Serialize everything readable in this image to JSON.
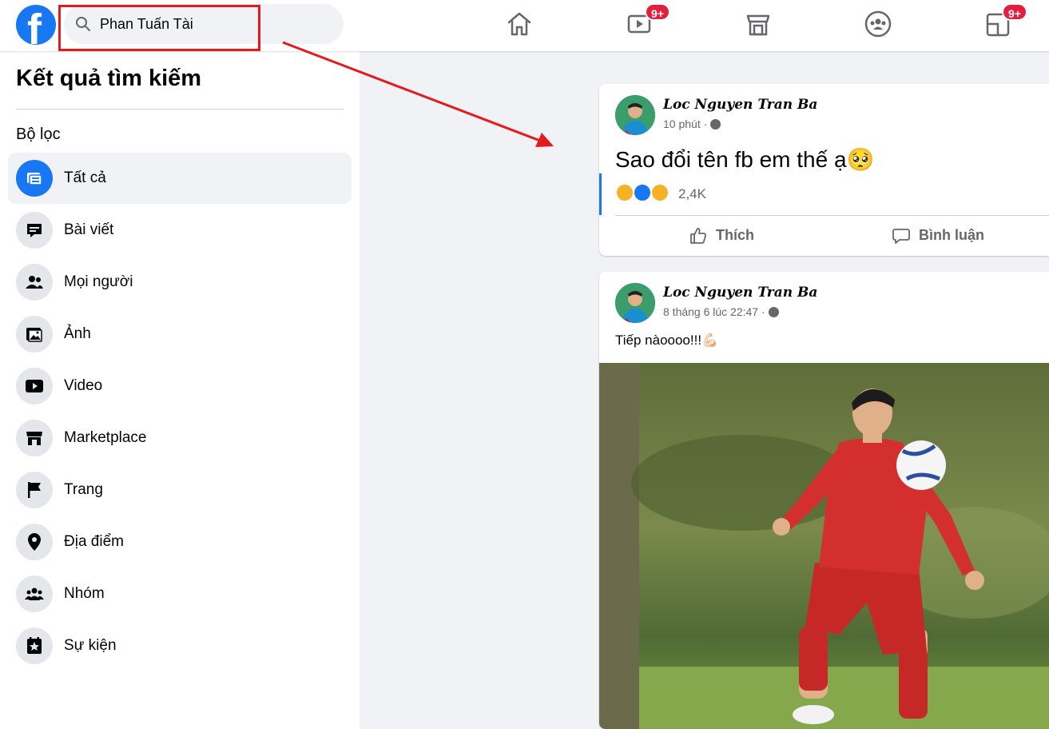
{
  "search": {
    "value": "Phan Tuấn Tài"
  },
  "nav": {
    "badges": {
      "watch": "9+",
      "menu": "9+"
    },
    "icons": [
      "home-icon",
      "watch-icon",
      "marketplace-icon",
      "groups-icon",
      "gaming-icon"
    ]
  },
  "sidebar": {
    "title": "Kết quả tìm kiếm",
    "filter_title": "Bộ lọc",
    "items": [
      {
        "label": "Tất cả",
        "icon": "all-results-icon",
        "active": true
      },
      {
        "label": "Bài viết",
        "icon": "posts-icon"
      },
      {
        "label": "Mọi người",
        "icon": "people-icon"
      },
      {
        "label": "Ảnh",
        "icon": "photos-icon"
      },
      {
        "label": "Video",
        "icon": "video-icon"
      },
      {
        "label": "Marketplace",
        "icon": "marketplace-icon"
      },
      {
        "label": "Trang",
        "icon": "pages-flag-icon"
      },
      {
        "label": "Địa điểm",
        "icon": "places-pin-icon"
      },
      {
        "label": "Nhóm",
        "icon": "groups-icon"
      },
      {
        "label": "Sự kiện",
        "icon": "events-star-icon"
      }
    ]
  },
  "posts": [
    {
      "author": "Loc Nguyen Tran Ba",
      "time": "10 phút ·",
      "text": "Sao đổi tên fb em thế ạ🥺",
      "reaction_count": "2,4K",
      "actions": {
        "like": "Thích",
        "comment": "Bình luận"
      }
    },
    {
      "author": "Loc Nguyen Tran Ba",
      "time": "8 tháng 6 lúc 22:47 ·",
      "text": "Tiếp nàoooo!!!💪🏻"
    }
  ],
  "colors": {
    "brand": "#1877f2",
    "badge": "#e41e3f",
    "annotation": "#e41a1c",
    "background": "#f0f2f5"
  }
}
